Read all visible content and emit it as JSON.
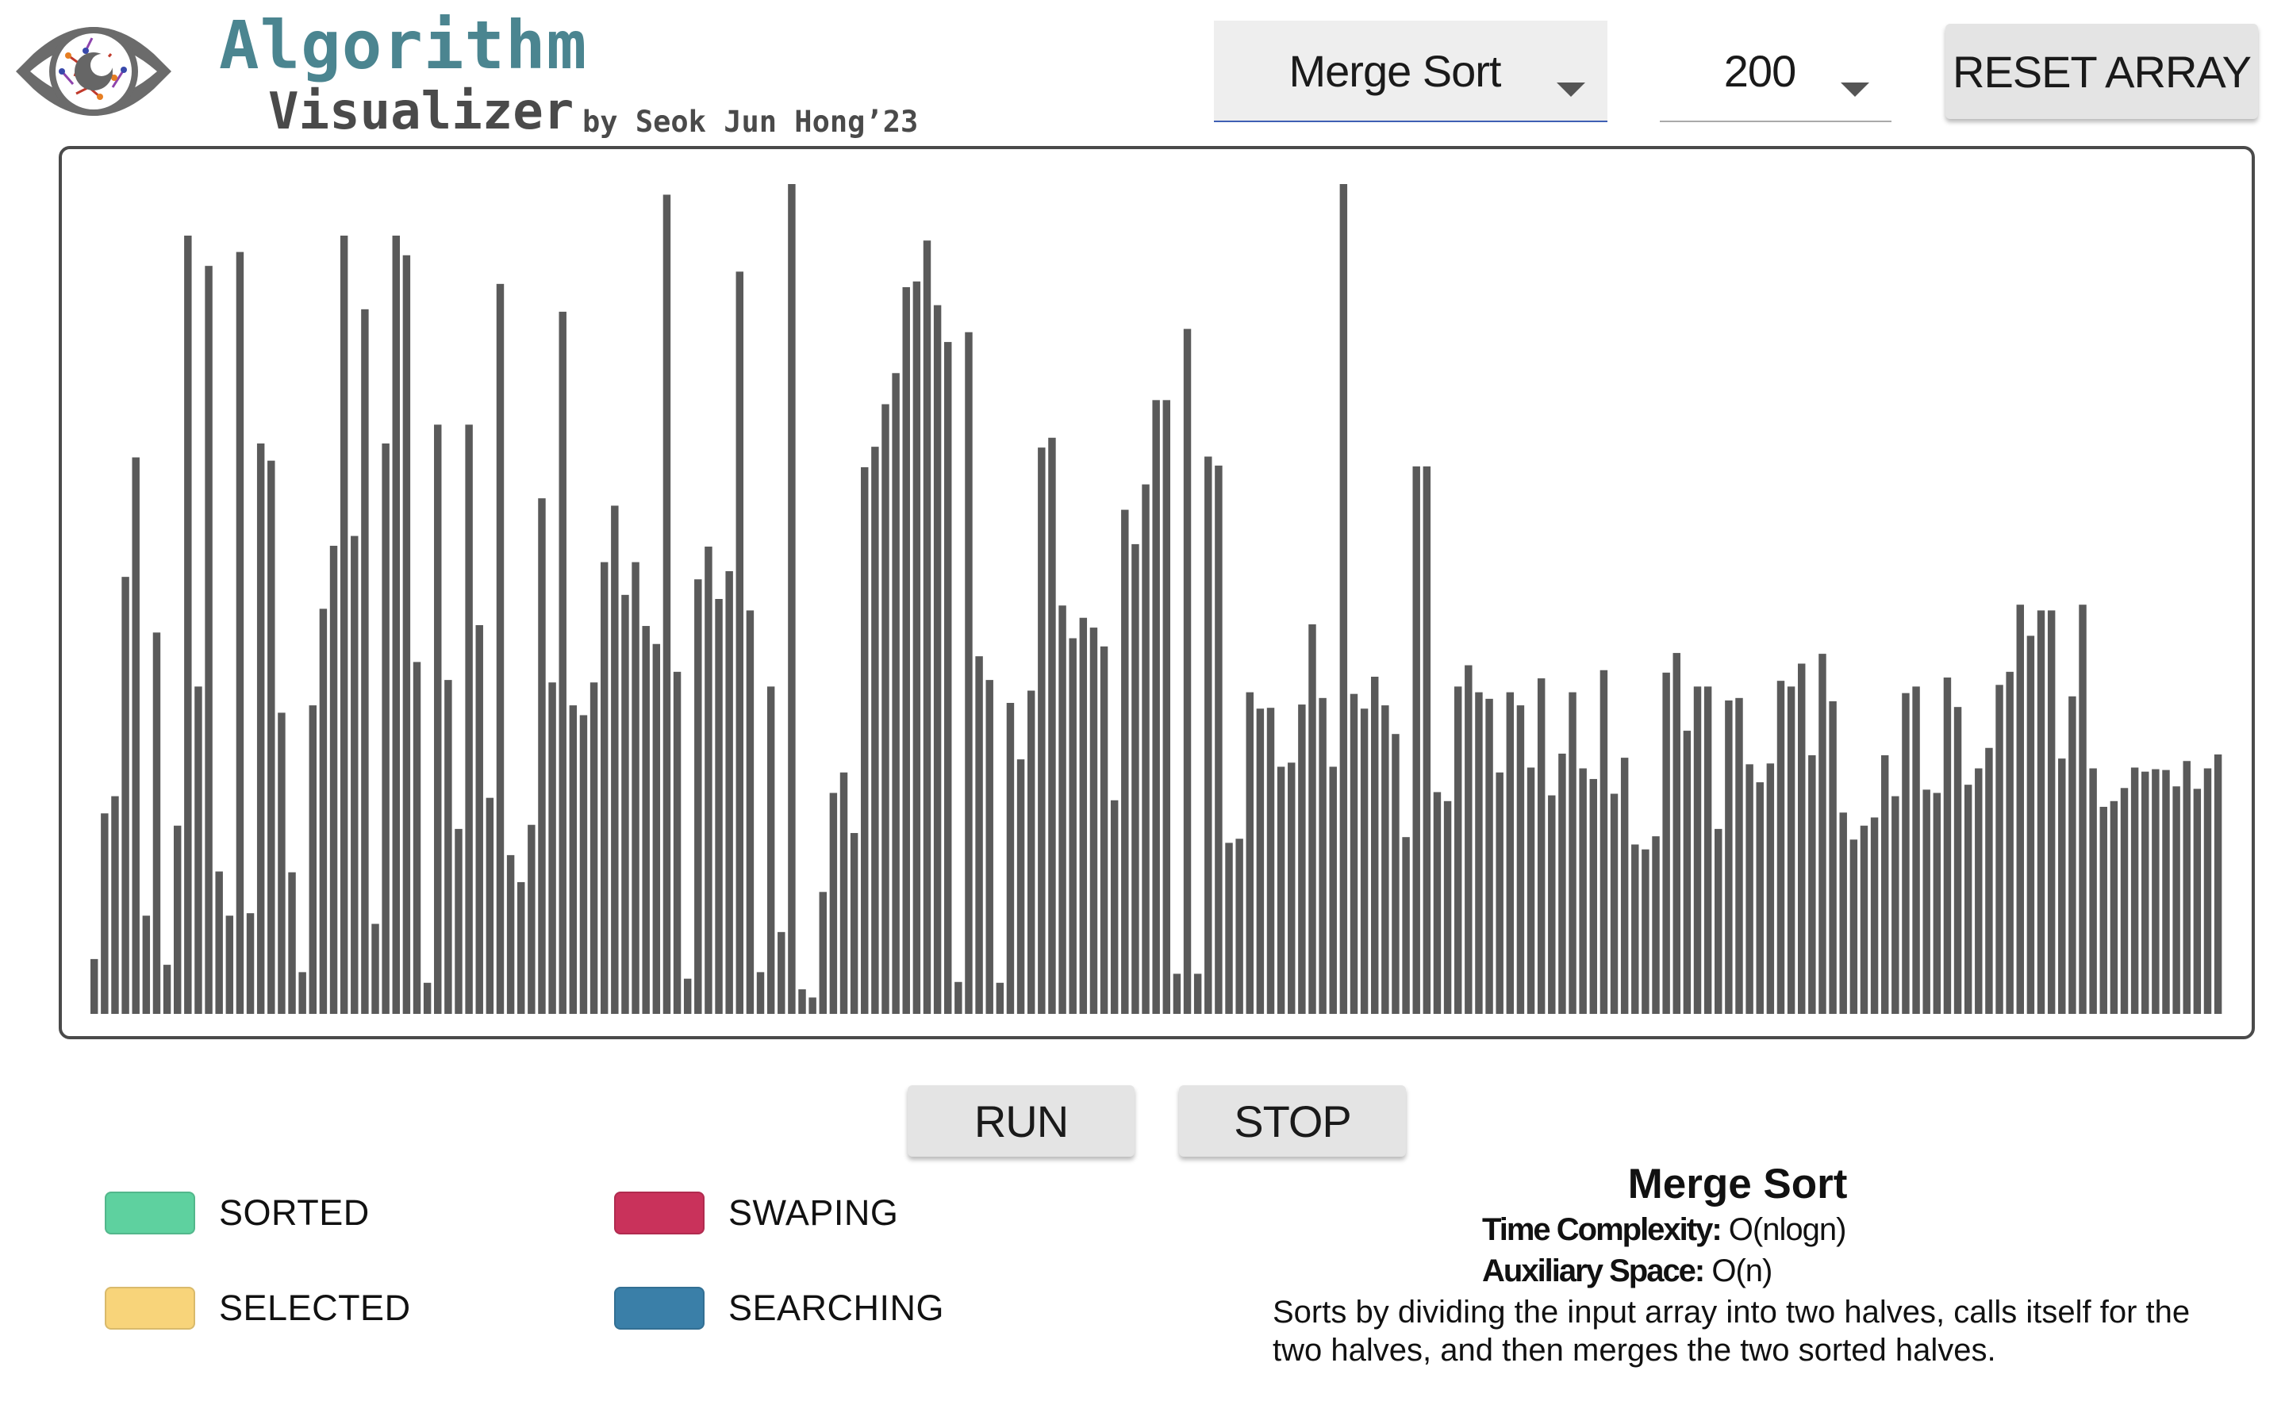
{
  "header": {
    "title_line1": "Algorithm",
    "title_line2": "Visualizer",
    "byline": "by Seok Jun Hong’23",
    "logo_icon": "eye-logo-icon"
  },
  "controls": {
    "algorithm_select": {
      "value": "Merge Sort",
      "icon": "chevron-down-icon"
    },
    "size_select": {
      "value": "200",
      "icon": "chevron-down-icon"
    },
    "reset_label": "RESET ARRAY",
    "run_label": "RUN",
    "stop_label": "STOP"
  },
  "bars": {
    "color": "#5a5a5a",
    "values": [
      67,
      245,
      266,
      534,
      680,
      120,
      466,
      60,
      230,
      951,
      400,
      914,
      174,
      120,
      931,
      123,
      697,
      676,
      368,
      173,
      51,
      377,
      495,
      572,
      951,
      584,
      861,
      110,
      697,
      951,
      927,
      430,
      38,
      720,
      408,
      226,
      720,
      475,
      264,
      892,
      194,
      161,
      231,
      630,
      405,
      858,
      377,
      365,
      405,
      552,
      621,
      512,
      552,
      474,
      452,
      1001,
      418,
      43,
      531,
      571,
      507,
      541,
      907,
      493,
      51,
      400,
      100,
      1014,
      30,
      20,
      149,
      270,
      295,
      221,
      668,
      693,
      745,
      783,
      888,
      895,
      945,
      866,
      821,
      39,
      833,
      437,
      408,
      38,
      380,
      311,
      395,
      692,
      704,
      499,
      459,
      484,
      472,
      449,
      261,
      616,
      574,
      647,
      750,
      750,
      49,
      837,
      49,
      681,
      670,
      209,
      214,
      393,
      373,
      374,
      302,
      307,
      378,
      476,
      386,
      302,
      1014,
      391,
      373,
      412,
      377,
      342,
      216,
      669,
      669,
      271,
      260,
      400,
      426,
      393,
      385,
      295,
      393,
      377,
      301,
      410,
      267,
      318,
      393,
      300,
      287,
      420,
      269,
      313,
      207,
      201,
      217,
      417,
      441,
      346,
      400,
      400,
      226,
      383,
      386,
      305,
      283,
      306,
      407,
      400,
      428,
      316,
      440,
      382,
      246,
      213,
      230,
      240,
      316,
      266,
      392,
      400,
      274,
      270,
      411,
      375,
      280,
      300,
      325,
      402,
      418,
      500,
      462,
      493,
      493,
      312,
      388,
      500,
      300,
      253,
      260,
      276,
      301,
      296,
      299,
      298,
      278,
      309,
      275,
      300,
      317
    ],
    "_comment": "bar heights as fraction-free relative values (max 1014 = full)"
  },
  "legend": [
    {
      "label": "SORTED",
      "color": "#5ed19f"
    },
    {
      "label": "SWAPING",
      "color": "#c9325b"
    },
    {
      "label": "SELECTED",
      "color": "#f8d47a"
    },
    {
      "label": "SEARCHING",
      "color": "#3a7fa8"
    }
  ],
  "info": {
    "title": "Merge Sort",
    "time_label": "Time Complexity:",
    "time_value": " O(nlogn)",
    "space_label": "Auxiliary Space:",
    "space_value": " O(n)",
    "description": "Sorts by dividing the input array into two halves, calls itself for the two halves, and then merges the two sorted halves."
  }
}
